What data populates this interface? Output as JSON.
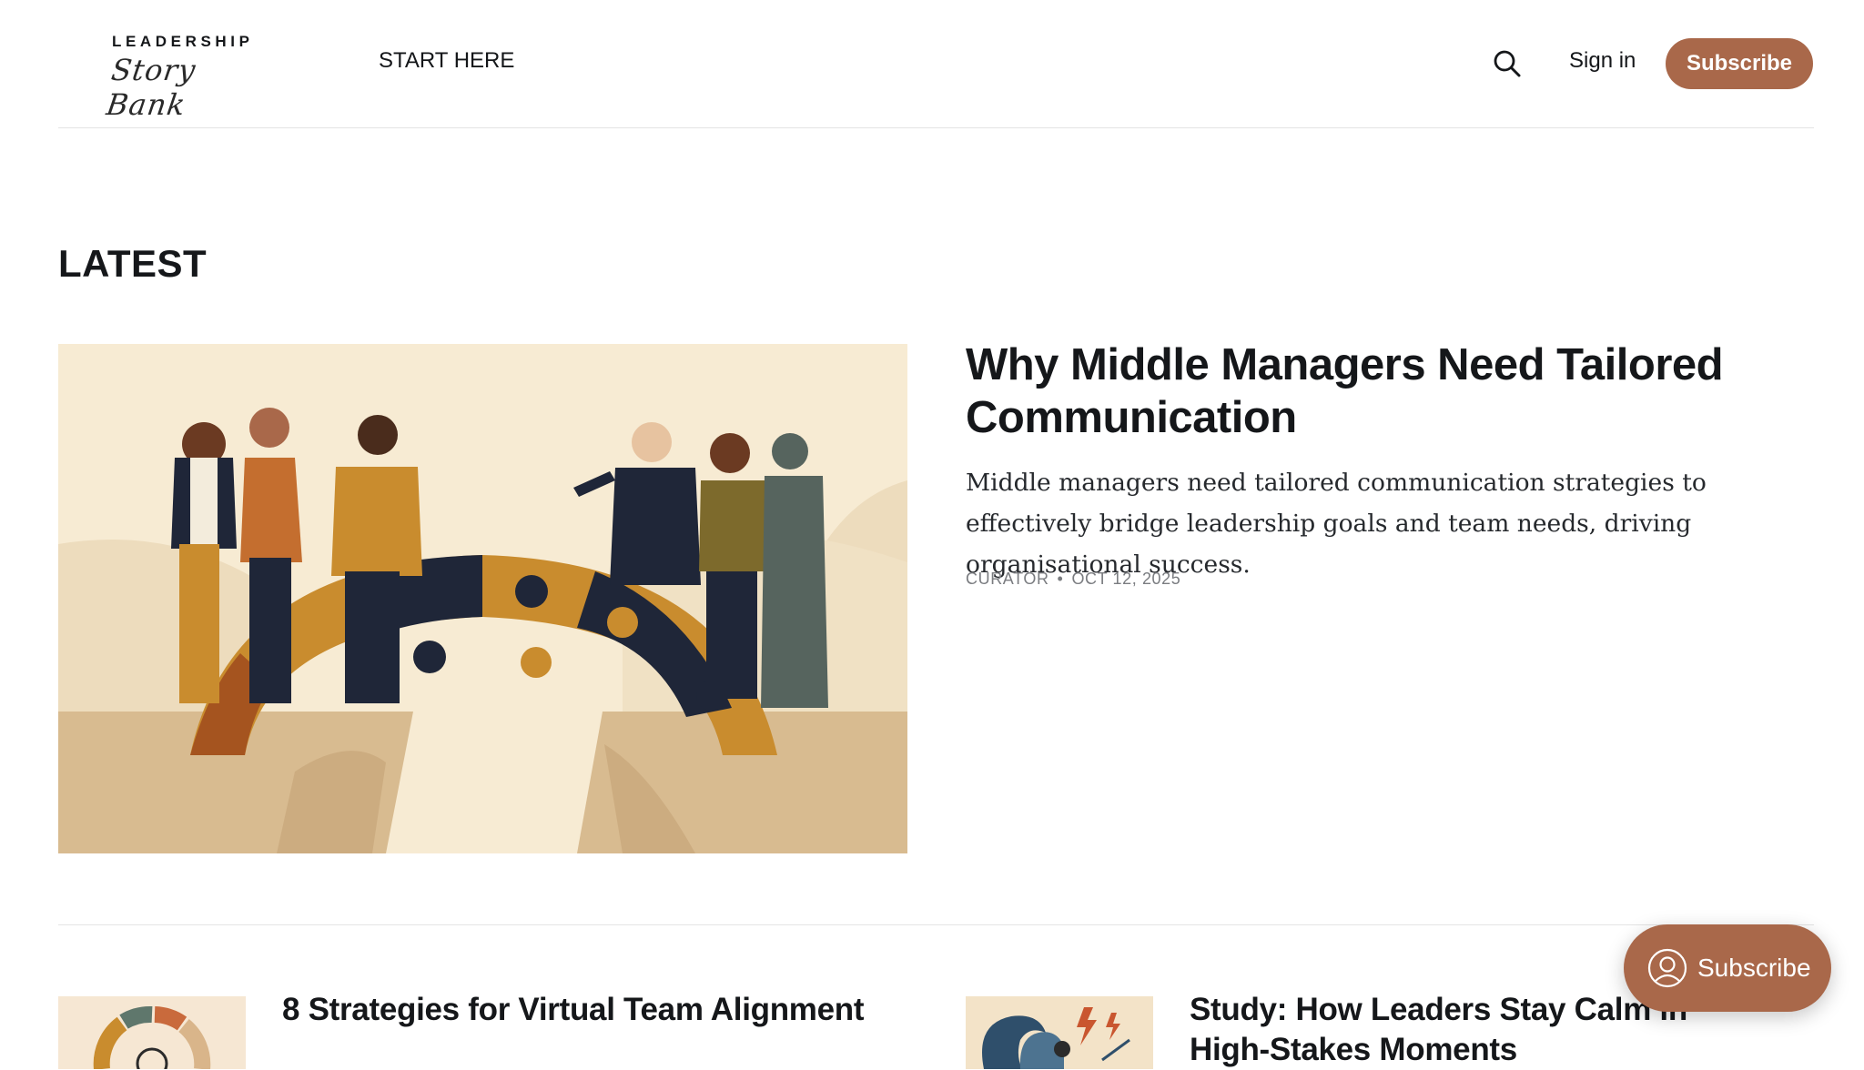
{
  "header": {
    "logo_top": "LEADERSHIP",
    "logo_script": "Story Bank",
    "nav": [
      "START HERE"
    ],
    "signin_label": "Sign in",
    "subscribe_label": "Subscribe",
    "search_icon": "search-icon",
    "accent_color": "#a9684a"
  },
  "latest": {
    "section_title": "LATEST",
    "feature": {
      "title": "Why Middle Managers Need Tailored Communication",
      "excerpt": "Middle managers need tailored communication strategies to effectively bridge leadership goals and team needs, driving organisational success.",
      "author": "CURATOR",
      "date": "OCT 12, 2025"
    },
    "cards": [
      {
        "title": "8 Strategies for Virtual Team Alignment"
      },
      {
        "title": "Study: How Leaders Stay Calm in High-Stakes Moments"
      }
    ]
  },
  "floating": {
    "subscribe_label": "Subscribe",
    "icon": "user-icon"
  }
}
